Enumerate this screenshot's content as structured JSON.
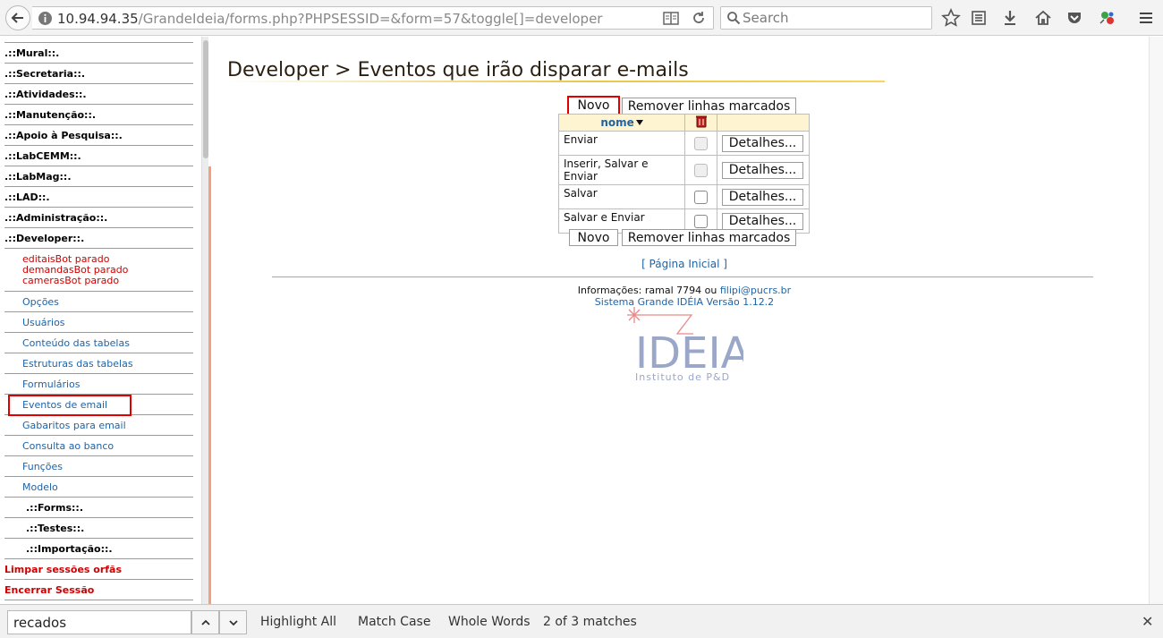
{
  "browser": {
    "url_host": "10.94.94.35",
    "url_rest": "/GrandeIdeia/forms.php?PHPSESSID=&form=57&toggle[]=developer",
    "search_placeholder": "Search"
  },
  "sidebar": {
    "sections_top": [
      ".::Mural::.",
      ".::Secretaria::.",
      ".::Atividades::.",
      ".::Manutenção::.",
      ".::Apoio à Pesquisa::.",
      ".::LabCEMM::.",
      ".::LabMag::.",
      ".::LAD::.",
      ".::Administração::.",
      ".::Developer::."
    ],
    "bots": [
      "editaisBot parado",
      "demandasBot parado",
      "camerasBot parado"
    ],
    "developer_items": [
      "Opções",
      "Usuários",
      "Conteúdo das tabelas",
      "Estruturas das tabelas",
      "Formulários",
      "Eventos de email",
      "Gabaritos para email",
      "Consulta ao banco",
      "Funções",
      "Modelo"
    ],
    "sub_sections": [
      ".::Forms::.",
      ".::Testes::.",
      ".::Importação::."
    ],
    "actions": [
      "Limpar sessões orfãs",
      "Encerrar Sessão"
    ]
  },
  "main": {
    "title": "Developer > Eventos que irão disparar e-mails",
    "new_label": "Novo",
    "remove_label": "Remover linhas marcados",
    "column_name": "nome",
    "details_label": "Detalhes...",
    "rows": [
      {
        "name": "Enviar",
        "checkbox_enabled": false
      },
      {
        "name": "Inserir, Salvar e Enviar",
        "checkbox_enabled": false
      },
      {
        "name": "Salvar",
        "checkbox_enabled": true
      },
      {
        "name": "Salvar e Enviar",
        "checkbox_enabled": true
      }
    ],
    "home_link": "[ Página Inicial ]",
    "info_prefix": "Informações: ramal 7794 ou ",
    "info_email": "filipi@pucrs.br",
    "version": "Sistema Grande IDÉIA Versão 1.12.2",
    "logo_text": "IDEIA",
    "logo_subtext": "Instituto de P&D"
  },
  "findbar": {
    "query": "recados",
    "highlight_all": "Highlight All",
    "match_case": "Match Case",
    "whole_words": "Whole Words",
    "status": "2 of 3 matches"
  },
  "colors": {
    "link": "#1f63a6",
    "alert": "#d00000",
    "highlight_box": "#e00000",
    "accent_bar": "#f3a07d",
    "table_header": "#fff4d2"
  }
}
